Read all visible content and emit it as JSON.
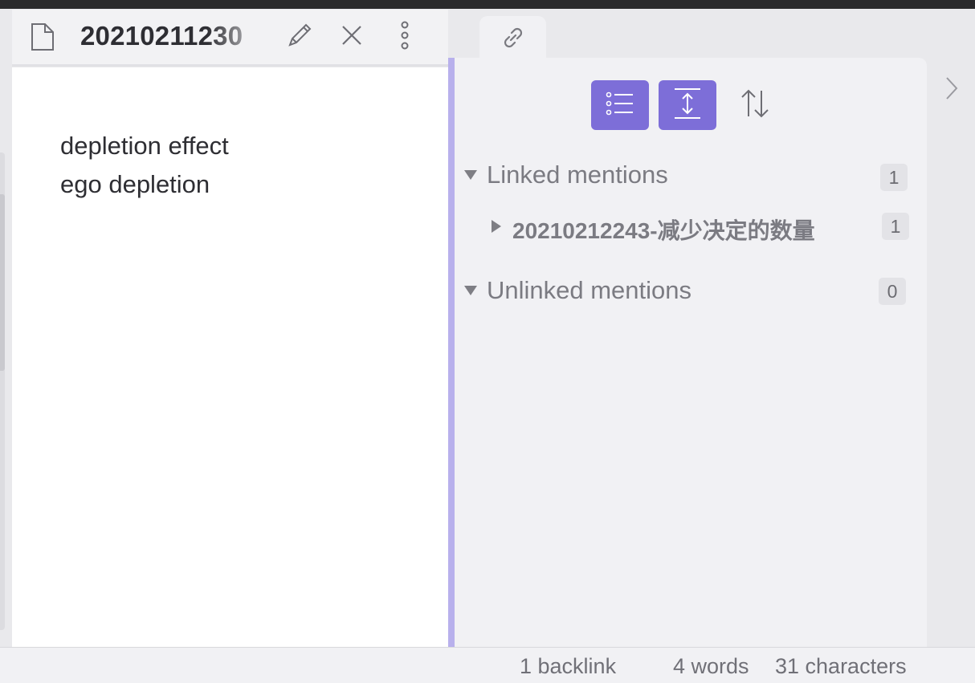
{
  "editor": {
    "title": "20210211230",
    "lines": [
      "depletion effect",
      "ego depletion"
    ]
  },
  "icons": {
    "file": "file-icon",
    "edit": "pencil-icon",
    "close": "close-icon",
    "more": "more-vertical-icon",
    "tab": "link-icon",
    "list": "list-icon",
    "expand": "expand-vertical-icon",
    "sort": "sort-icon",
    "collapse_sidebar": "chevron-right-icon"
  },
  "backlinks": {
    "linked": {
      "label": "Linked mentions",
      "count": "1",
      "items": [
        {
          "title": "20210212243-减少决定的数量",
          "count": "1"
        }
      ]
    },
    "unlinked": {
      "label": "Unlinked mentions",
      "count": "0"
    }
  },
  "status": {
    "backlinks": "1 backlink",
    "words": "4 words",
    "characters": "31 characters"
  },
  "colors": {
    "accent": "#7d6ed8",
    "divider": "#b8b0ec"
  }
}
